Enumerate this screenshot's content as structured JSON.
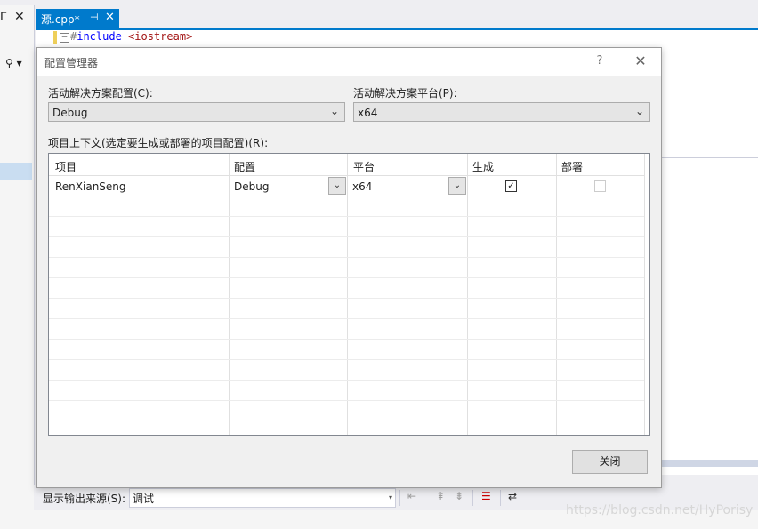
{
  "editor": {
    "tab_title": "源.cpp*",
    "pin_glyph": "⊣",
    "close_glyph": "✕",
    "code_line": "#include <iostream>",
    "code_hash": "#",
    "code_include": "include",
    "code_header": "<iostream>",
    "fold_glyph": "−"
  },
  "left_pane": {
    "pin_glyph": "ᒥ",
    "close_glyph": "✕",
    "search_glyph": "⚲ ▾"
  },
  "output": {
    "source_label": "显示输出来源(S):",
    "source_value": "调试",
    "arrow": "▾",
    "watermark": "https://blog.csdn.net/HyPorisy"
  },
  "dialog": {
    "title": "配置管理器",
    "help": "?",
    "close": "✕",
    "config_label": "活动解决方案配置(C):",
    "config_value": "Debug",
    "platform_label": "活动解决方案平台(P):",
    "platform_value": "x64",
    "combo_arrow": "⌄",
    "context_label": "项目上下文(选定要生成或部署的项目配置)(R):",
    "close_button": "关闭",
    "columns": [
      "项目",
      "配置",
      "平台",
      "生成",
      "部署"
    ],
    "rows": [
      {
        "project": "RenXianSeng",
        "config": "Debug",
        "platform": "x64",
        "build": true,
        "deploy": false
      }
    ]
  }
}
